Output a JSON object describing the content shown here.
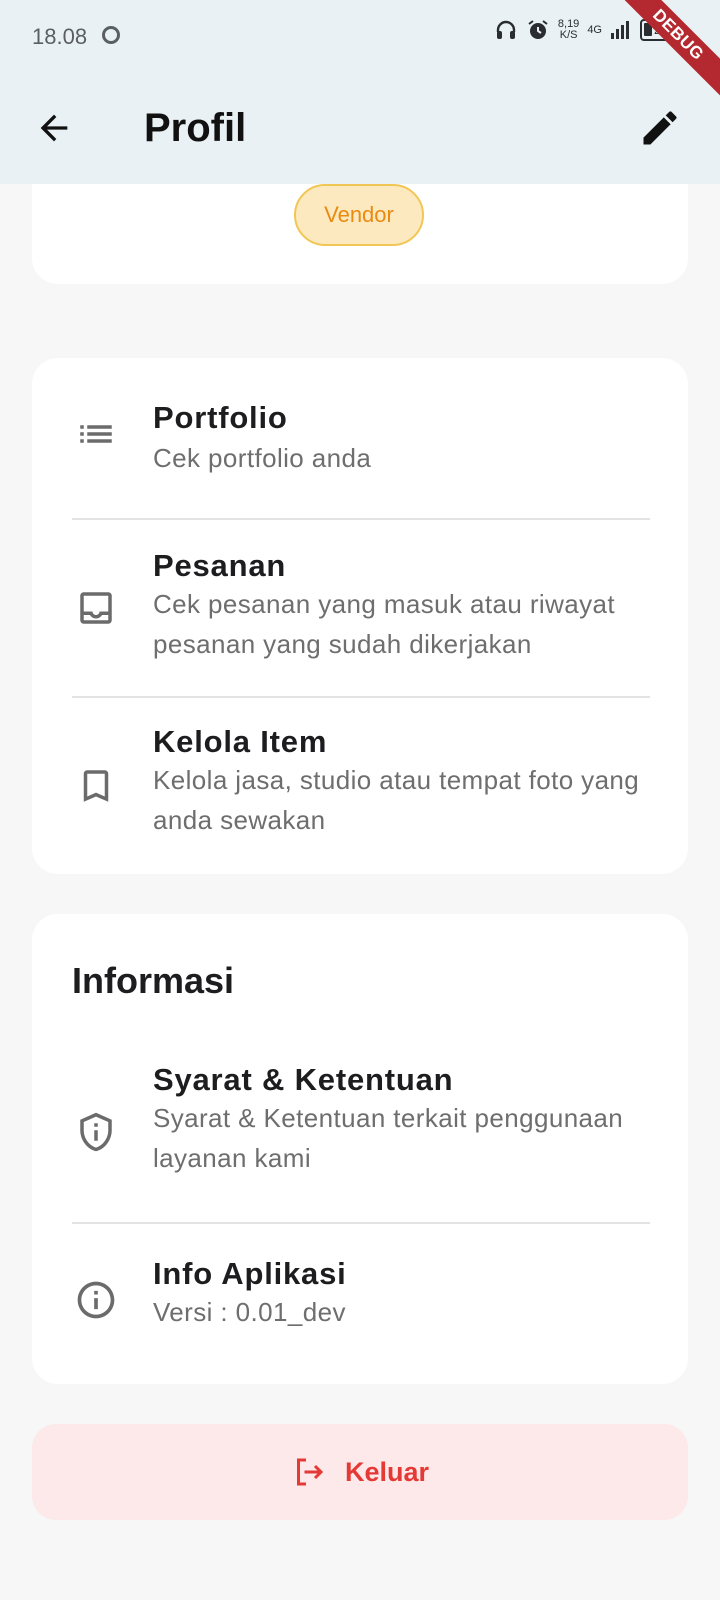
{
  "status_bar": {
    "time": "18.08",
    "net_speed_value": "8,19",
    "net_speed_unit": "K/S",
    "network": "4G",
    "battery": "20"
  },
  "debug_banner": "DEBUG",
  "app_bar": {
    "title": "Profil"
  },
  "profile": {
    "role_badge": "Vendor"
  },
  "menu": [
    {
      "title": "Portfolio",
      "subtitle": "Cek portfolio anda",
      "icon": "list-icon"
    },
    {
      "title": "Pesanan",
      "subtitle": "Cek pesanan yang masuk atau riwayat pesanan yang sudah dikerjakan",
      "icon": "inbox-icon"
    },
    {
      "title": "Kelola Item",
      "subtitle": "Kelola jasa, studio atau tempat foto yang anda sewakan",
      "icon": "bookmark-icon"
    }
  ],
  "info": {
    "heading": "Informasi",
    "items": [
      {
        "title": "Syarat & Ketentuan",
        "subtitle": "Syarat & Ketentuan terkait penggunaan layanan kami",
        "icon": "shield-info-icon"
      },
      {
        "title": "Info Aplikasi",
        "subtitle": "Versi : 0.01_dev",
        "icon": "info-icon"
      }
    ]
  },
  "logout": {
    "label": "Keluar",
    "color": "#e53935",
    "background": "#fde8ea"
  },
  "colors": {
    "app_bar_bg": "#e9f1f4",
    "badge_bg": "#fde9bf",
    "badge_text": "#ea8a10"
  }
}
